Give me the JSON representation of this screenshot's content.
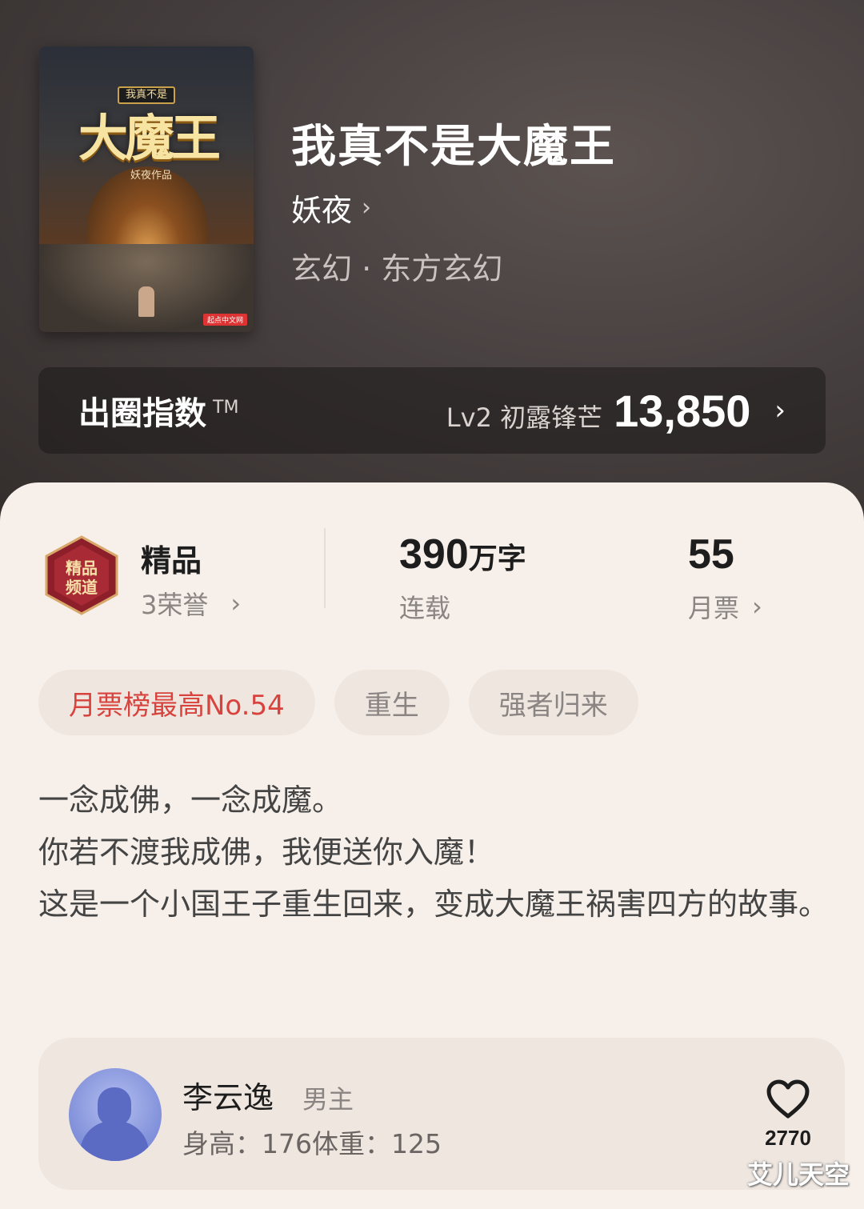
{
  "book": {
    "cover": {
      "title_small": "我真不是",
      "title_big": "大魔王",
      "author_line": "妖夜作品",
      "brand": "起点中文网"
    },
    "title": "我真不是大魔王",
    "author": "妖夜",
    "genre": "玄幻 · 东方玄幻"
  },
  "index_bar": {
    "label": "出圈指数",
    "tm": "TM",
    "level": "Lv2 初露锋芒",
    "value": "13,850"
  },
  "stats": {
    "badge_text": "精品频道",
    "quality_label": "精品",
    "honors": "3荣誉",
    "word_count": "390",
    "word_unit": "万字",
    "status": "连载",
    "votes": "55",
    "votes_label": "月票"
  },
  "tags": [
    "月票榜最高No.54",
    "重生",
    "强者归来"
  ],
  "description": [
    "一念成佛，一念成魔。",
    "你若不渡我成佛，我便送你入魔！",
    "这是一个小国王子重生回来，变成大魔王祸害四方的故事。"
  ],
  "character": {
    "name": "李云逸",
    "role": "男主",
    "info": "身高：176体重：125",
    "likes": "2770"
  },
  "watermark": "艾儿天空",
  "colors": {
    "accent_red": "#d8433e",
    "panel_bg": "#f7f0ea",
    "tag_bg": "#efe6e0"
  }
}
